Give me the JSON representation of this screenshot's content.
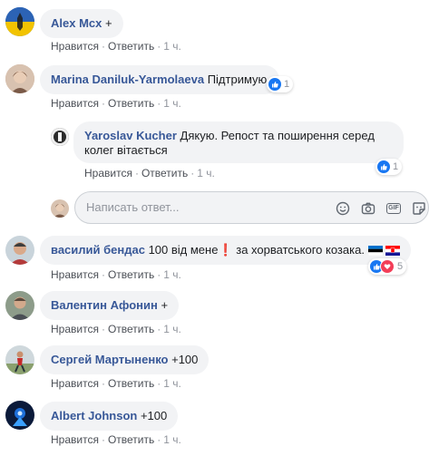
{
  "actions": {
    "like": "Нравится",
    "reply": "Ответить",
    "sep": "·"
  },
  "comments": [
    {
      "author": "Alex Mcx",
      "text": "+",
      "time": "1 ч."
    },
    {
      "author": "Marina Daniluk-Yarmolaeva",
      "text": "Підтримую",
      "time": "1 ч.",
      "reactions": "1"
    },
    {
      "author": "Yaroslav Kucher",
      "text": "Дякую. Репост та поширення серед колег вітається",
      "time": "1 ч.",
      "reactions": "1"
    },
    {
      "author": "василий бендас",
      "text": "100 від мене❗ за хорватського козака.",
      "time": "1 ч.",
      "reactions": "5"
    },
    {
      "author": "Валентин Афонин",
      "text": "+",
      "time": "1 ч."
    },
    {
      "author": "Сергей Мартыненко",
      "text": "+100",
      "time": "1 ч."
    },
    {
      "author": "Albert Johnson",
      "text": "+100",
      "time": "1 ч."
    }
  ],
  "reply_input": {
    "placeholder": "Написать ответ..."
  },
  "colors": {
    "author": "#385898",
    "bubble": "#f2f3f5",
    "meta": "#90949c",
    "like": "#1877f2",
    "love": "#f33e58"
  }
}
